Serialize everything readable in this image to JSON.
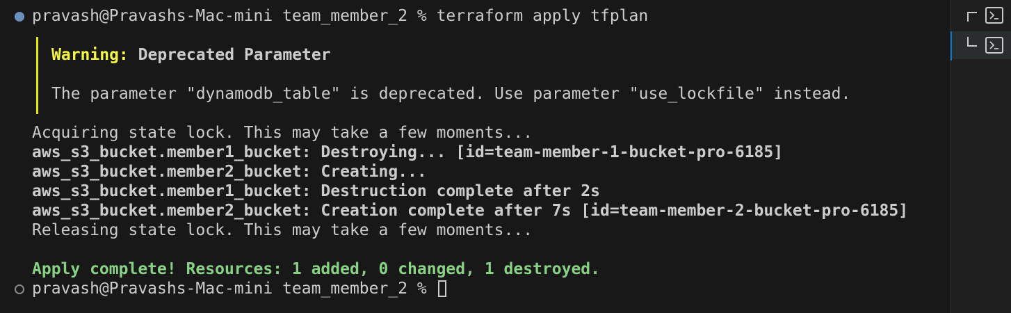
{
  "terminal": {
    "prompt_line": "pravash@Pravashs-Mac-mini team_member_2 % terraform apply tfplan",
    "warning": {
      "label": "Warning:",
      "title": "Deprecated Parameter",
      "message": "The parameter \"dynamodb_table\" is deprecated. Use parameter \"use_lockfile\" instead."
    },
    "lines": [
      {
        "text": "Acquiring state lock. This may take a few moments...",
        "bold": false
      },
      {
        "text": "aws_s3_bucket.member1_bucket: Destroying... [id=team-member-1-bucket-pro-6185]",
        "bold": true
      },
      {
        "text": "aws_s3_bucket.member2_bucket: Creating...",
        "bold": true
      },
      {
        "text": "aws_s3_bucket.member1_bucket: Destruction complete after 2s",
        "bold": true
      },
      {
        "text": "aws_s3_bucket.member2_bucket: Creation complete after 7s [id=team-member-2-bucket-pro-6185]",
        "bold": true
      },
      {
        "text": "Releasing state lock. This may take a few moments...",
        "bold": false
      }
    ],
    "apply_complete": "Apply complete! Resources: 1 added, 0 changed, 1 destroyed.",
    "final_prompt": "pravash@Pravashs-Mac-mini team_member_2 % "
  },
  "colors": {
    "background": "#181818",
    "text": "#cccccc",
    "warning": "#f5f543",
    "success": "#89d185",
    "active_tab_accent": "#0078d4"
  },
  "tabs": [
    {
      "icon": "terminal-icon",
      "active": false
    },
    {
      "icon": "terminal-icon",
      "active": true
    }
  ]
}
